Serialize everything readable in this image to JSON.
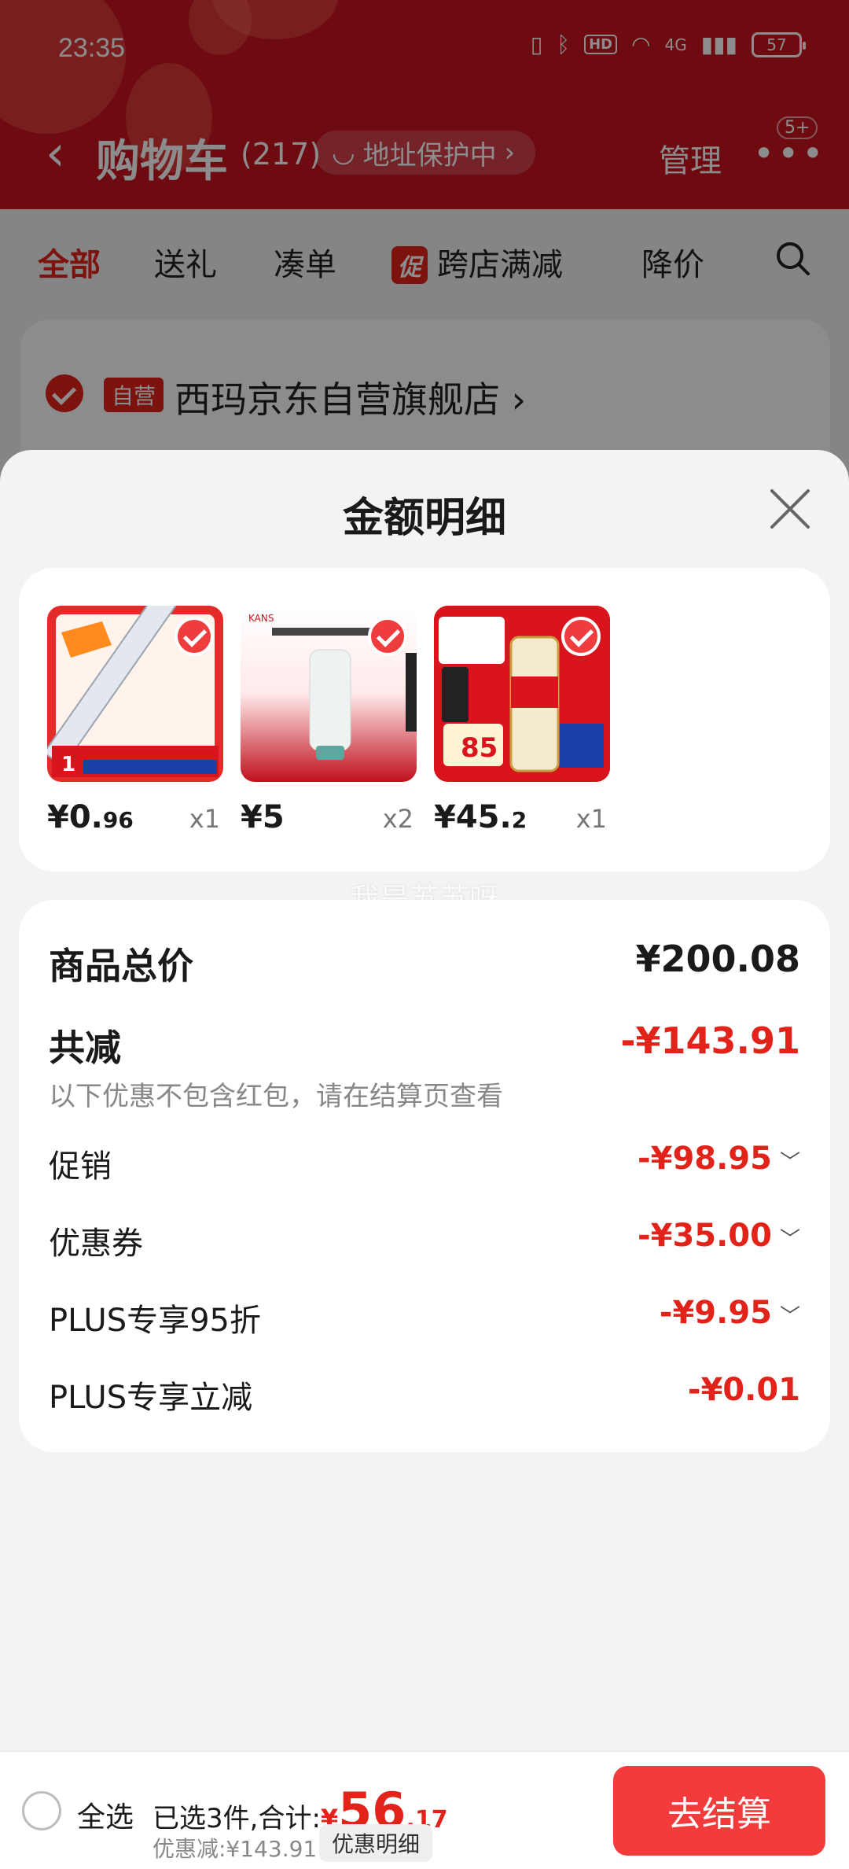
{
  "status_bar": {
    "time": "23:35",
    "network": "4G",
    "hd": "HD",
    "battery": "57"
  },
  "header": {
    "back": "‹",
    "title": "购物车",
    "count": "(217)",
    "address_protect": "地址保护中",
    "manage": "管理",
    "more": "•••",
    "badge": "5+"
  },
  "filters": [
    {
      "label": "全部",
      "active": true
    },
    {
      "label": "送礼"
    },
    {
      "label": "凑单"
    },
    {
      "label": "跨店满减",
      "tag": "促"
    },
    {
      "label": "降价"
    }
  ],
  "store": {
    "self_operated": "自营",
    "name": "西玛京东自营旗舰店",
    "chevron": "›"
  },
  "sheet": {
    "title": "金额明细",
    "products": [
      {
        "price_main": "¥0.",
        "price_small": "96",
        "qty": "x1",
        "icon": "ruler"
      },
      {
        "price_main": "¥5",
        "price_small": "",
        "qty": "x2",
        "icon": "cleanser"
      },
      {
        "price_main": "¥45.",
        "price_small": "2",
        "qty": "x1",
        "icon": "beer"
      }
    ],
    "watermark": "我是苏苏呀",
    "total_label": "商品总价",
    "total_value": "¥200.08",
    "reduce_label": "共减",
    "reduce_value": "-¥143.91",
    "reduce_note": "以下优惠不包含红包，请在结算页查看",
    "items": [
      {
        "label": "促销",
        "value": "-¥98.95",
        "expand": true
      },
      {
        "label": "优惠券",
        "value": "-¥35.00",
        "expand": true
      },
      {
        "label": "PLUS专享95折",
        "value": "-¥9.95",
        "expand": true
      },
      {
        "label": "PLUS专享立减",
        "value": "-¥0.01",
        "expand": false
      }
    ]
  },
  "bottom": {
    "select_all": "全选",
    "selected_text": "已选3件,合计:",
    "total_currency": "¥",
    "total_int": "56",
    "total_dec": ".17",
    "discount": "优惠减:¥143.91",
    "detail": "优惠明细",
    "checkout": "去结算"
  },
  "colors": {
    "brand_red": "#e2231a",
    "header_red": "#c8141e",
    "checkout": "#f33b3b"
  }
}
